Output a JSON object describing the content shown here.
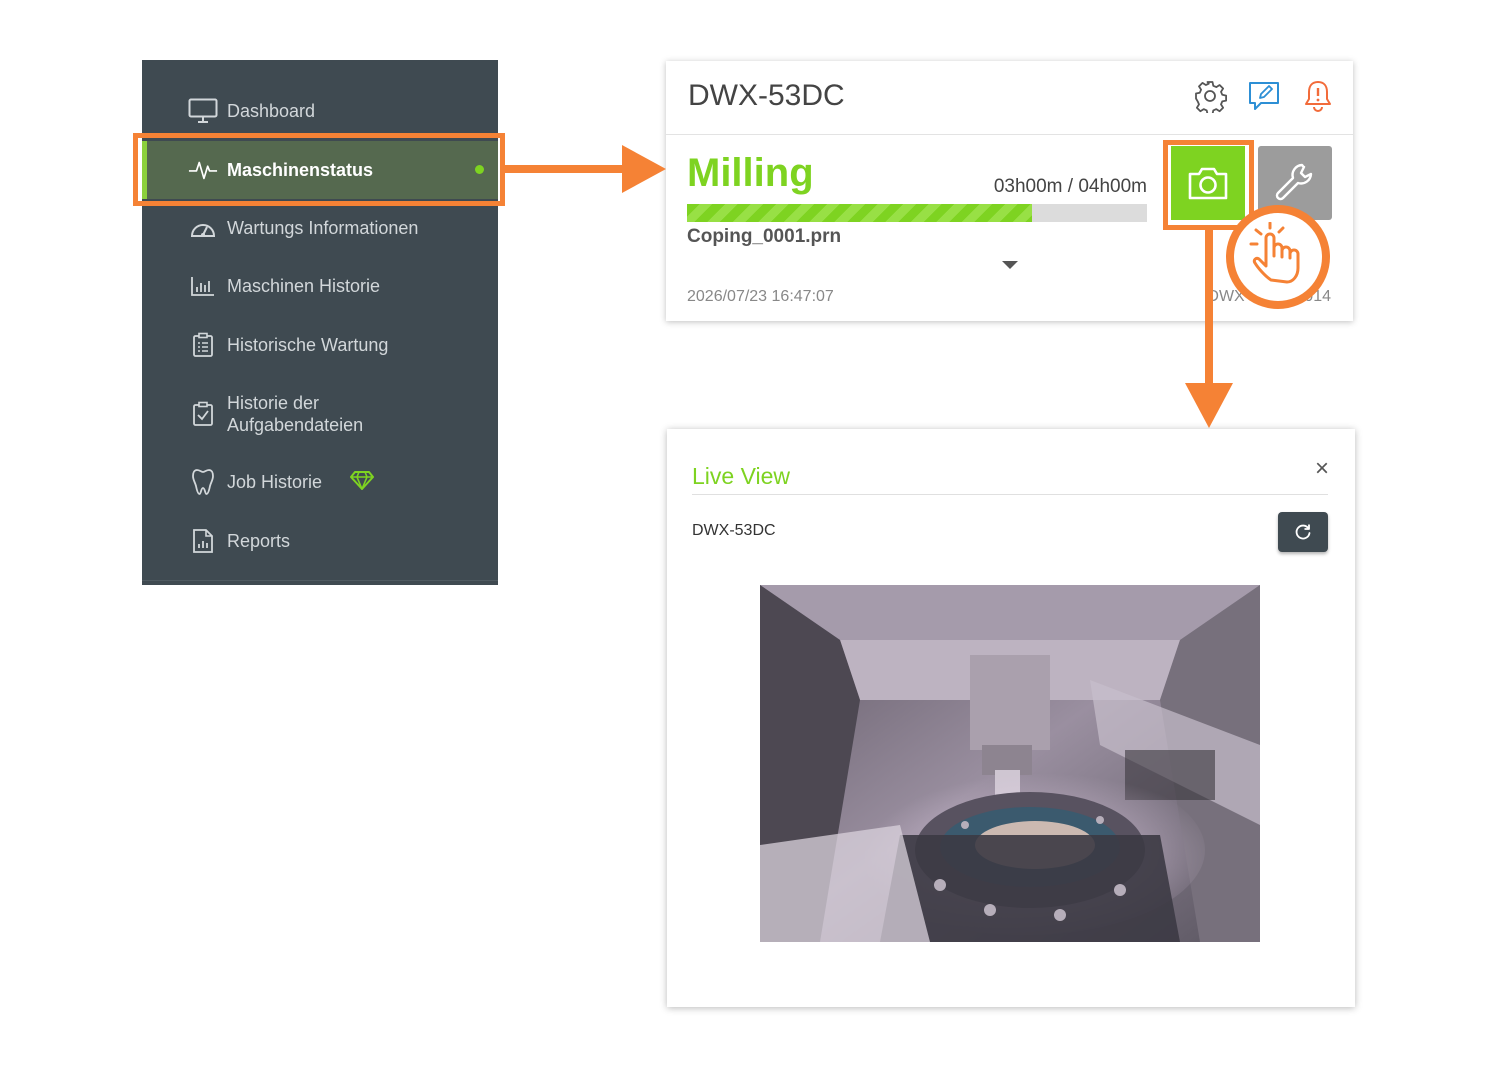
{
  "sidebar": {
    "items": [
      {
        "label": "Dashboard",
        "icon": "monitor-icon"
      },
      {
        "label": "Maschinenstatus",
        "icon": "pulse-icon",
        "active": true
      },
      {
        "label": "Wartungs Informationen",
        "icon": "gauge-icon"
      },
      {
        "label": "Maschinen Historie",
        "icon": "bar-chart-icon"
      },
      {
        "label": "Historische Wartung",
        "icon": "clipboard-list-icon"
      },
      {
        "label": "Historie der Aufgabendateien",
        "icon": "clipboard-check-icon"
      },
      {
        "label": "Job Historie",
        "icon": "tooth-icon",
        "badge": "diamond-icon"
      },
      {
        "label": "Reports",
        "icon": "report-icon"
      }
    ]
  },
  "machine_card": {
    "title": "DWX-53DC",
    "status": "Milling",
    "time": "03h00m / 04h00m",
    "progress": 0.75,
    "file": "Coping_0001.prn",
    "date": "2026/07/23 16:47:07",
    "serial": "DWX-53DC 0014"
  },
  "live_view": {
    "title": "Live View",
    "close": "×",
    "device": "DWX-53DC"
  },
  "colors": {
    "sidebar_bg": "#3f4a51",
    "active_bg": "#55694f",
    "accent_green": "#7ed321",
    "highlight_orange": "#f58235",
    "alert_orange": "#f26b3a",
    "edit_blue": "#2d8fd5"
  }
}
